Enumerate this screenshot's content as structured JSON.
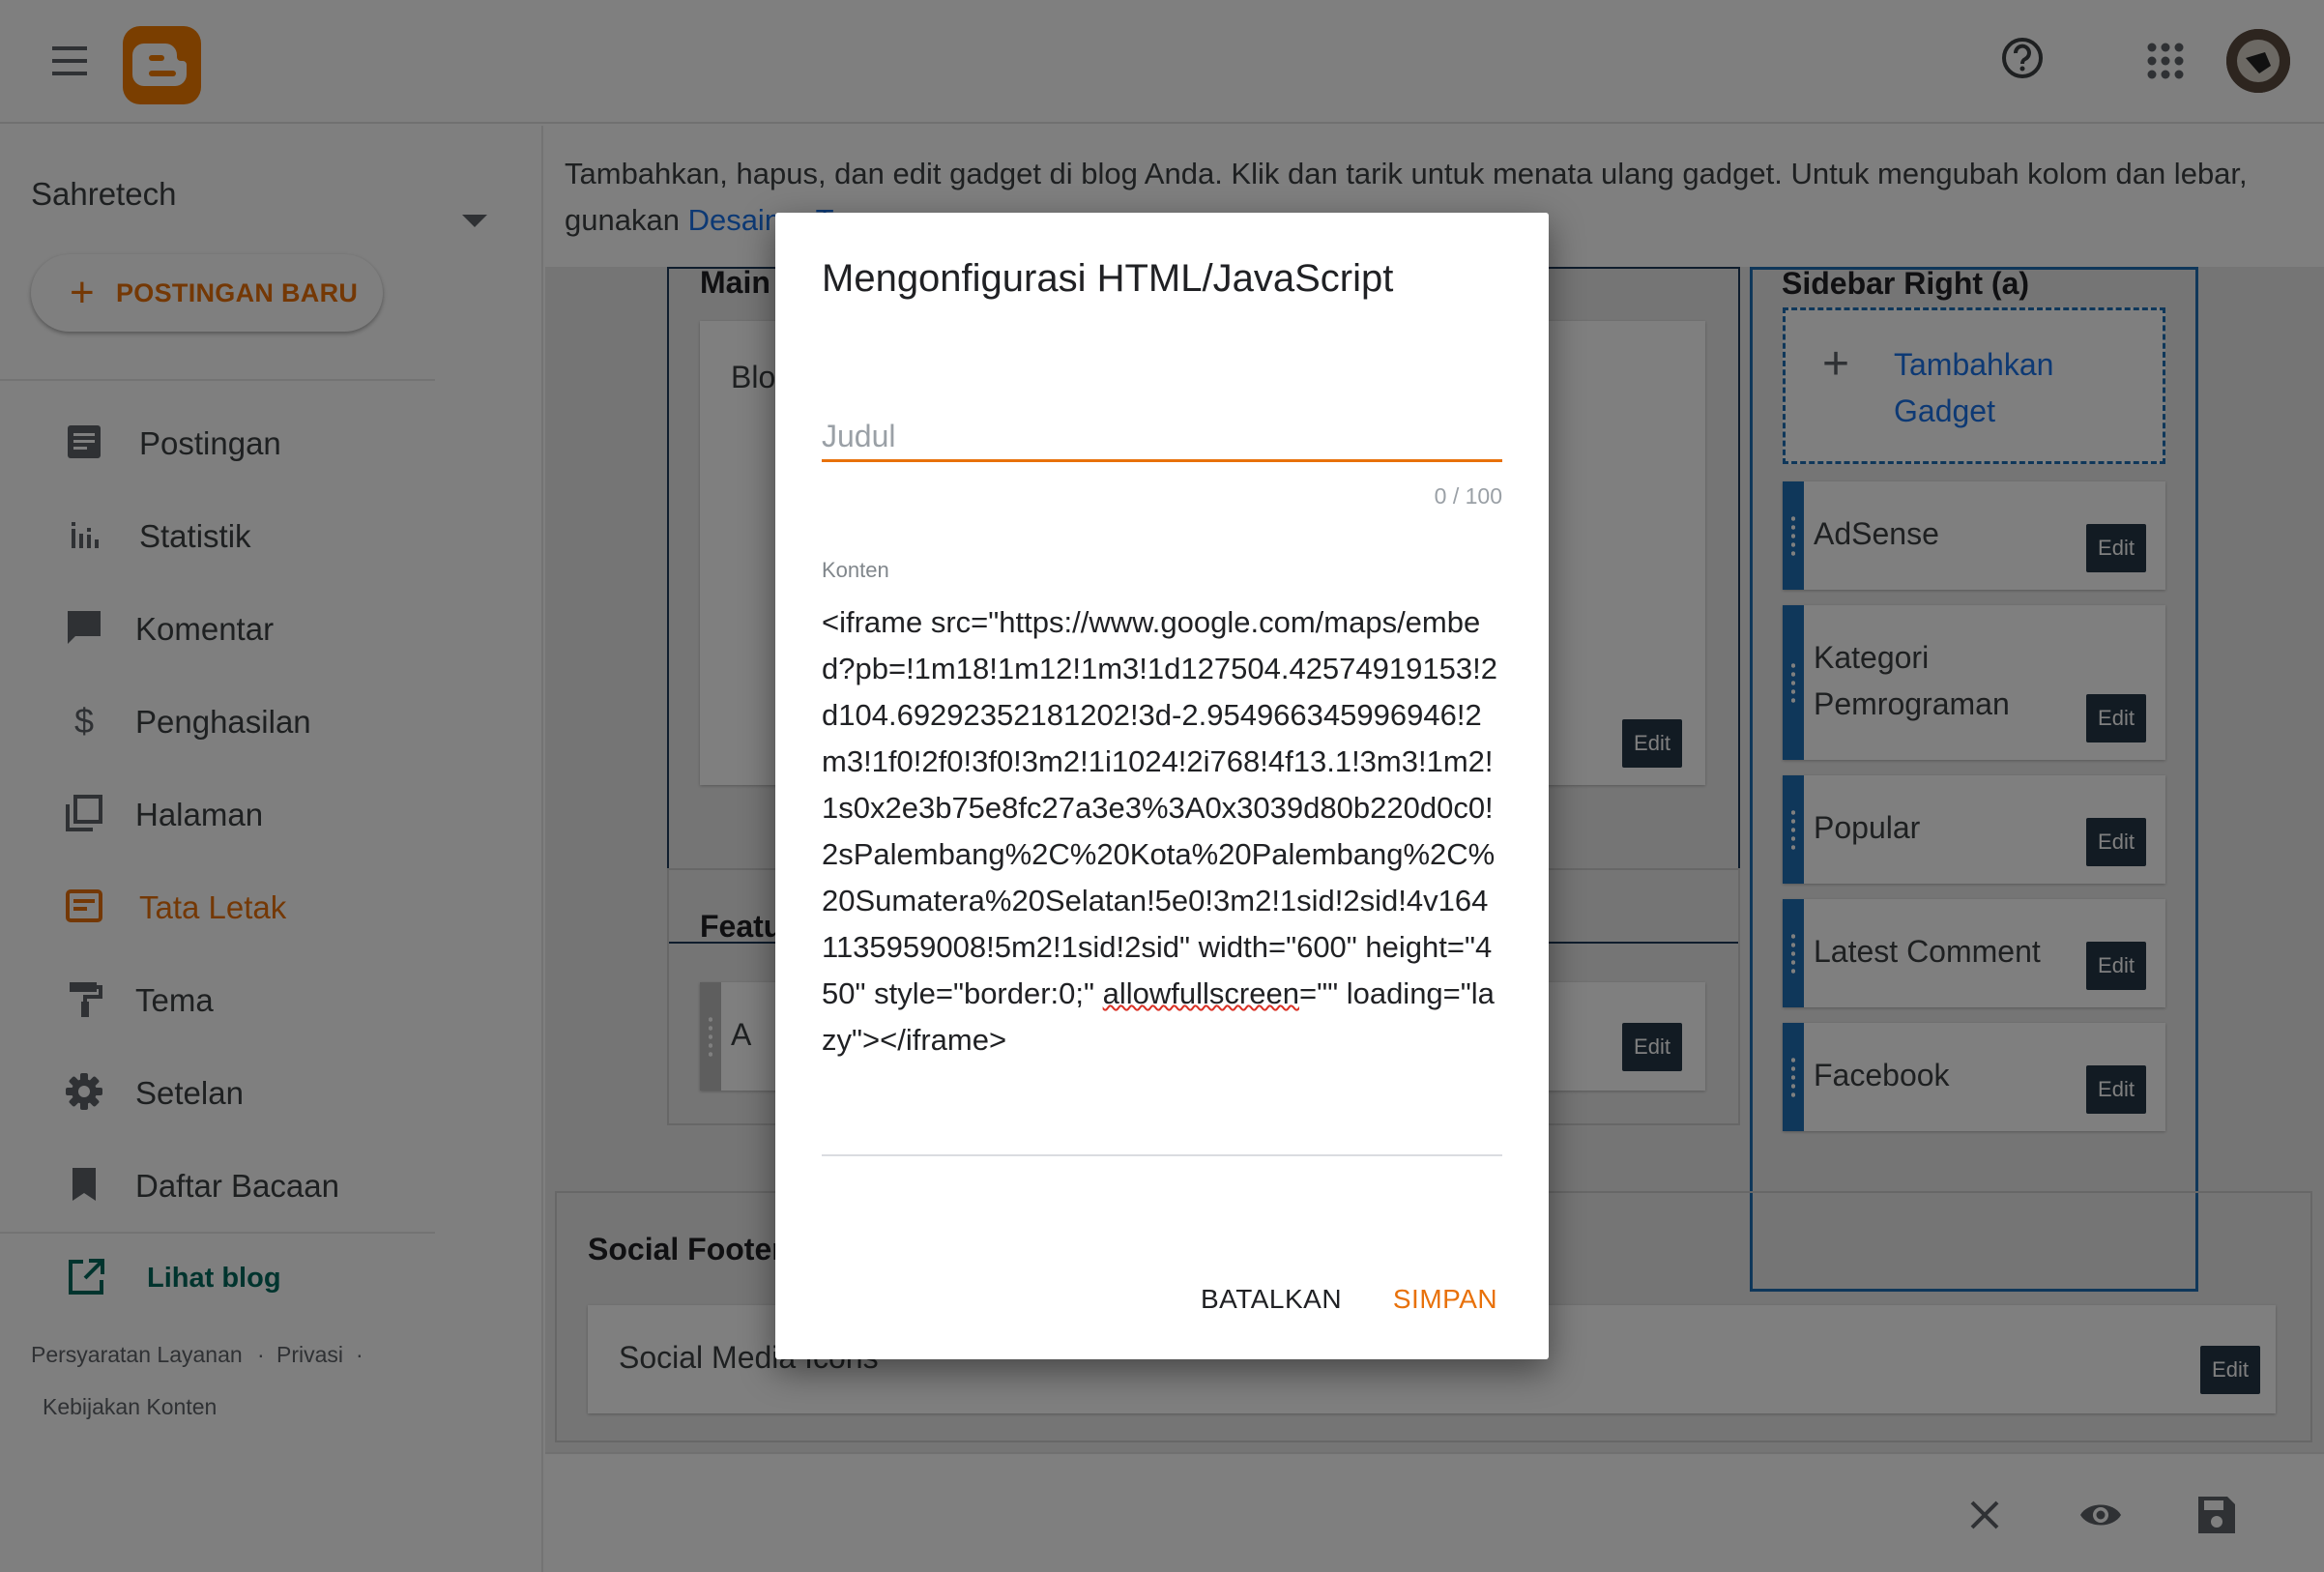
{
  "topbar": {
    "help_icon": "help-circle-icon",
    "apps_icon": "apps-grid-icon",
    "logo_icon": "blogger-logo-icon"
  },
  "sidebar": {
    "blog_name": "Sahretech",
    "new_post_label": "POSTINGAN BARU",
    "items": [
      {
        "label": "Postingan",
        "icon": "posts-icon"
      },
      {
        "label": "Statistik",
        "icon": "stats-icon"
      },
      {
        "label": "Komentar",
        "icon": "comment-icon"
      },
      {
        "label": "Penghasilan",
        "icon": "dollar-icon"
      },
      {
        "label": "Halaman",
        "icon": "pages-icon"
      },
      {
        "label": "Tata Letak",
        "icon": "layout-icon",
        "active": true
      },
      {
        "label": "Tema",
        "icon": "paint-roller-icon"
      },
      {
        "label": "Setelan",
        "icon": "gear-icon"
      },
      {
        "label": "Daftar Bacaan",
        "icon": "bookmark-icon"
      }
    ],
    "view_blog_label": "Lihat blog",
    "footer_links": [
      "Persyaratan Layanan",
      "Privasi",
      "Kebijakan Konten"
    ],
    "footer_separator": "·"
  },
  "main": {
    "intro_text": "Tambahkan, hapus, dan edit gadget di blog Anda. Klik dan tarik untuk menata ulang gadget. Untuk mengubah kolom dan lebar, gunakan ",
    "intro_link": "Desainer Tema",
    "intro_end": ".",
    "main_section_title": "Main",
    "main_gadget_name": "Blog Posts",
    "featured_section_title": "Featured Post",
    "featured_gadget_name": "A",
    "sidebar_section_title": "Sidebar Right (a)",
    "add_gadget_label": "Tambahkan Gadget",
    "edit_label": "Edit",
    "sidebar_gadgets": [
      "AdSense",
      "Kategori Pemrograman",
      "Popular",
      "Latest Comment",
      "Facebook"
    ],
    "social_footer_title": "Social Footer",
    "social_gadget_name": "Social Media Icons",
    "accent_color": "#1e6fb4"
  },
  "bottombar": {
    "close_icon": "close-icon",
    "preview_icon": "eye-icon",
    "save_icon": "floppy-disk-icon"
  },
  "dialog": {
    "title": "Mengonfigurasi HTML/JavaScript",
    "title_field_placeholder": "Judul",
    "title_field_value": "",
    "char_count": "0 / 100",
    "content_label": "Konten",
    "content_before": "<iframe src=\"https://www.google.com/maps/embed?pb=!1m18!1m12!1m3!1d127504.42574919153!2d104.69292352181202!3d-2.954966345996946!2m3!1f0!2f0!3f0!3m2!1i1024!2i768!4f13.1!3m3!1m2!1s0x2e3b75e8fc27a3e3%3A0x3039d80b220d0c0!2sPalembang%2C%20Kota%20Palembang%2C%20Sumatera%20Selatan!5e0!3m2!1sid!2sid!4v1641135959008!5m2!1sid!2sid\" width=\"600\" height=\"450\" style=\"border:0;\" ",
    "content_misspelled": "allowfullscreen",
    "content_after": "=\"\" loading=\"lazy\"></iframe>",
    "cancel_label": "BATALKAN",
    "save_label": "SIMPAN",
    "accent_color": "#e8710a"
  }
}
